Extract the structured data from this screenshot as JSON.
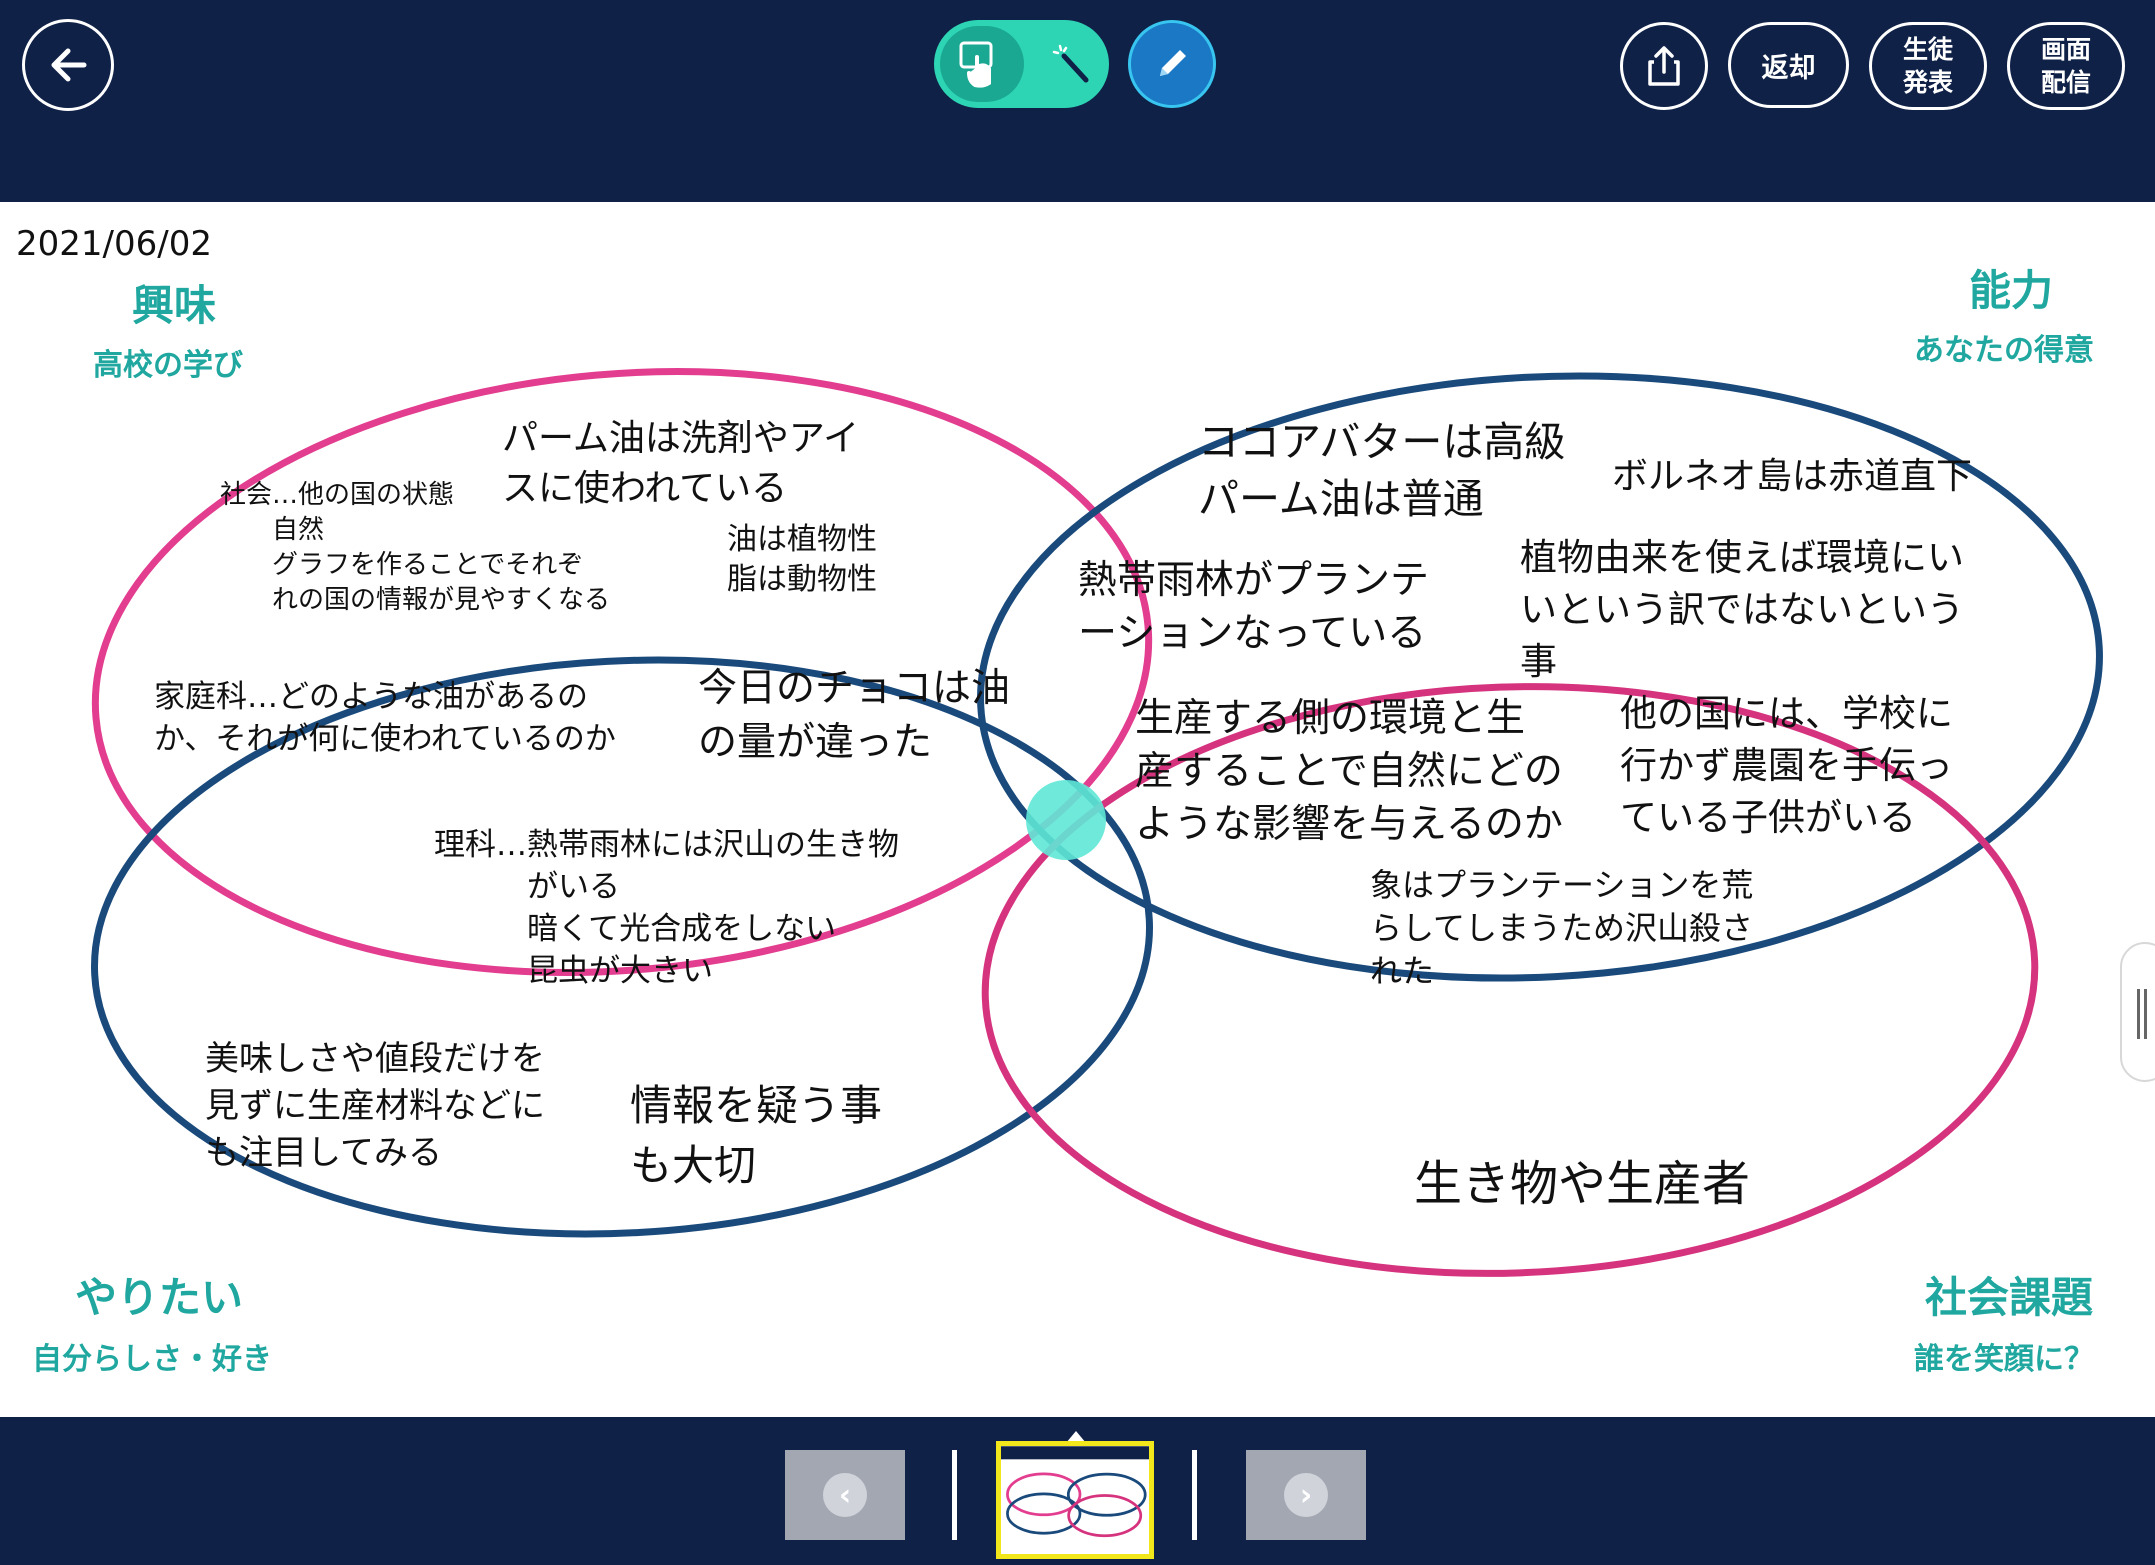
{
  "toolbar": {
    "return_label": "返却",
    "present_label": "生徒\n発表",
    "screen_label": "画面\n配信",
    "icons": {
      "back": "arrow-left-icon",
      "touch": "touch-hand-icon",
      "magic": "magic-wand-icon",
      "pen": "pencil-icon",
      "share": "share-icon"
    }
  },
  "canvas": {
    "date": "2021/06/02",
    "quadrants": {
      "interest": {
        "title": "興味",
        "subtitle": "高校の学び",
        "color": "#1fa7a0"
      },
      "ability": {
        "title": "能力",
        "subtitle": "あなたの得意",
        "color": "#1fa7a0"
      },
      "want": {
        "title": "やりたい",
        "subtitle": "自分らしさ・好き",
        "color": "#1fa7a0"
      },
      "social": {
        "title": "社会課題",
        "subtitle": "誰を笑顔に？",
        "color": "#1fa7a0"
      }
    },
    "notes": {
      "palm_oil_usage": "パーム油は洗剤やアイ\nスに使われている",
      "social_studies": "社会…他の国の状態\n　　自然\n　　グラフを作ることでそれぞ\n　　れの国の情報が見やすくなる",
      "oil_fat": "油は植物性\n脂は動物性",
      "home_ec": "家庭科…どのような油があるの\nか、それが何に使われているのか",
      "chocolate": "今日のチョコは油\nの量が違った",
      "science": "理科…熱帯雨林には沢山の生き物\n　　　がいる\n　　　暗くて光合成をしない\n　　　昆虫が大きい",
      "cocoa_butter": "ココアバターは高級\nパーム油は普通",
      "borneo": "ボルネオ島は赤道直下",
      "rainforest": "熱帯雨林がプランテ\nーションなっている",
      "plant_origin": "植物由来を使えば環境にい\nいという訳ではないという\n事",
      "producer_env": "生産する側の環境と生\n産することで自然にどの\nような影響を与えるのか",
      "children": "他の国には、学校に\n行かず農園を手伝っ\nている子供がいる",
      "elephants": "象はプランテーションを荒\nらしてしまうため沢山殺さ\nれた",
      "taste_price": "美味しさや値段だけを\n見ずに生産材料などに\nも注目してみる",
      "doubt_info": "情報を疑う事\nも大切",
      "creatures": "生き物や生産者"
    },
    "ring_colors": {
      "pink": "#e33d8f",
      "navy": "#1a4a7c",
      "center": "#5fe8d6"
    }
  },
  "pager": {
    "prev_label": "‹",
    "next_label": "›"
  }
}
